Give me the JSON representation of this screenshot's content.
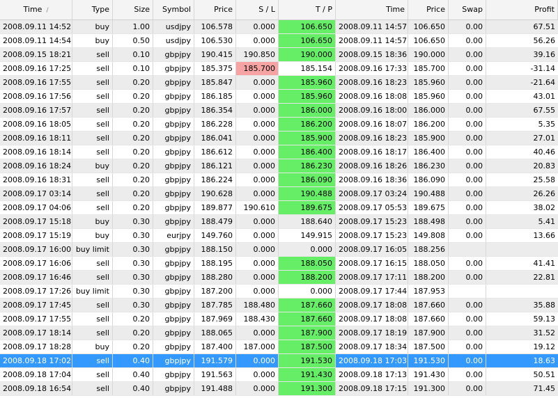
{
  "columns": [
    "Time",
    "Type",
    "Size",
    "Symbol",
    "Price",
    "S / L",
    "T / P",
    "Time",
    "Price",
    "Swap",
    "Profit"
  ],
  "sort_indicator": "/",
  "rows": [
    {
      "open_time": "2008.09.11 14:52",
      "type": "buy",
      "size": "1.00",
      "symbol": "usdjpy",
      "price": "106.578",
      "sl": "0.000",
      "tp": "106.650",
      "close_time": "2008.09.11 14:57",
      "close_price": "106.650",
      "swap": "0.00",
      "profit": "67.51",
      "tp_hit": true,
      "sl_hit": false
    },
    {
      "open_time": "2008.09.11 14:54",
      "type": "buy",
      "size": "0.50",
      "symbol": "usdjpy",
      "price": "106.530",
      "sl": "0.000",
      "tp": "106.650",
      "close_time": "2008.09.11 14:57",
      "close_price": "106.650",
      "swap": "0.00",
      "profit": "56.26",
      "tp_hit": true,
      "sl_hit": false
    },
    {
      "open_time": "2008.09.15 18:21",
      "type": "sell",
      "size": "0.10",
      "symbol": "gbpjpy",
      "price": "190.415",
      "sl": "190.850",
      "tp": "190.000",
      "close_time": "2008.09.15 18:36",
      "close_price": "190.000",
      "swap": "0.00",
      "profit": "39.16",
      "tp_hit": true,
      "sl_hit": false
    },
    {
      "open_time": "2008.09.16 17:25",
      "type": "sell",
      "size": "0.10",
      "symbol": "gbpjpy",
      "price": "185.375",
      "sl": "185.700",
      "tp": "185.154",
      "close_time": "2008.09.16 17:33",
      "close_price": "185.700",
      "swap": "0.00",
      "profit": "-31.14",
      "tp_hit": false,
      "sl_hit": true
    },
    {
      "open_time": "2008.09.16 17:55",
      "type": "sell",
      "size": "0.20",
      "symbol": "gbpjpy",
      "price": "185.847",
      "sl": "0.000",
      "tp": "185.960",
      "close_time": "2008.09.16 18:23",
      "close_price": "185.960",
      "swap": "0.00",
      "profit": "-21.64",
      "tp_hit": true,
      "sl_hit": false
    },
    {
      "open_time": "2008.09.16 17:56",
      "type": "sell",
      "size": "0.20",
      "symbol": "gbpjpy",
      "price": "186.185",
      "sl": "0.000",
      "tp": "185.960",
      "close_time": "2008.09.16 18:08",
      "close_price": "185.960",
      "swap": "0.00",
      "profit": "43.01",
      "tp_hit": true,
      "sl_hit": false
    },
    {
      "open_time": "2008.09.16 17:57",
      "type": "sell",
      "size": "0.20",
      "symbol": "gbpjpy",
      "price": "186.354",
      "sl": "0.000",
      "tp": "186.000",
      "close_time": "2008.09.16 18:00",
      "close_price": "186.000",
      "swap": "0.00",
      "profit": "67.55",
      "tp_hit": true,
      "sl_hit": false
    },
    {
      "open_time": "2008.09.16 18:05",
      "type": "sell",
      "size": "0.20",
      "symbol": "gbpjpy",
      "price": "186.228",
      "sl": "0.000",
      "tp": "186.200",
      "close_time": "2008.09.16 18:07",
      "close_price": "186.200",
      "swap": "0.00",
      "profit": "5.35",
      "tp_hit": true,
      "sl_hit": false
    },
    {
      "open_time": "2008.09.16 18:11",
      "type": "sell",
      "size": "0.20",
      "symbol": "gbpjpy",
      "price": "186.041",
      "sl": "0.000",
      "tp": "185.900",
      "close_time": "2008.09.16 18:23",
      "close_price": "185.900",
      "swap": "0.00",
      "profit": "27.01",
      "tp_hit": true,
      "sl_hit": false
    },
    {
      "open_time": "2008.09.16 18:14",
      "type": "sell",
      "size": "0.20",
      "symbol": "gbpjpy",
      "price": "186.612",
      "sl": "0.000",
      "tp": "186.400",
      "close_time": "2008.09.16 18:17",
      "close_price": "186.400",
      "swap": "0.00",
      "profit": "40.46",
      "tp_hit": true,
      "sl_hit": false
    },
    {
      "open_time": "2008.09.16 18:24",
      "type": "buy",
      "size": "0.20",
      "symbol": "gbpjpy",
      "price": "186.121",
      "sl": "0.000",
      "tp": "186.230",
      "close_time": "2008.09.16 18:26",
      "close_price": "186.230",
      "swap": "0.00",
      "profit": "20.83",
      "tp_hit": true,
      "sl_hit": false
    },
    {
      "open_time": "2008.09.16 18:31",
      "type": "sell",
      "size": "0.20",
      "symbol": "gbpjpy",
      "price": "186.224",
      "sl": "0.000",
      "tp": "186.090",
      "close_time": "2008.09.16 18:36",
      "close_price": "186.090",
      "swap": "0.00",
      "profit": "25.58",
      "tp_hit": true,
      "sl_hit": false
    },
    {
      "open_time": "2008.09.17 03:14",
      "type": "sell",
      "size": "0.20",
      "symbol": "gbpjpy",
      "price": "190.628",
      "sl": "0.000",
      "tp": "190.488",
      "close_time": "2008.09.17 03:24",
      "close_price": "190.488",
      "swap": "0.00",
      "profit": "26.26",
      "tp_hit": true,
      "sl_hit": false
    },
    {
      "open_time": "2008.09.17 04:06",
      "type": "sell",
      "size": "0.20",
      "symbol": "gbpjpy",
      "price": "189.877",
      "sl": "190.610",
      "tp": "189.675",
      "close_time": "2008.09.17 05:53",
      "close_price": "189.675",
      "swap": "0.00",
      "profit": "38.02",
      "tp_hit": true,
      "sl_hit": false
    },
    {
      "open_time": "2008.09.17 15:18",
      "type": "buy",
      "size": "0.30",
      "symbol": "gbpjpy",
      "price": "188.479",
      "sl": "0.000",
      "tp": "188.640",
      "close_time": "2008.09.17 15:23",
      "close_price": "188.498",
      "swap": "0.00",
      "profit": "5.41",
      "tp_hit": false,
      "sl_hit": false
    },
    {
      "open_time": "2008.09.17 15:19",
      "type": "buy",
      "size": "0.30",
      "symbol": "eurjpy",
      "price": "149.760",
      "sl": "0.000",
      "tp": "149.915",
      "close_time": "2008.09.17 15:23",
      "close_price": "149.808",
      "swap": "0.00",
      "profit": "13.66",
      "tp_hit": false,
      "sl_hit": false
    },
    {
      "open_time": "2008.09.17 16:00",
      "type": "buy limit",
      "size": "0.30",
      "symbol": "gbpjpy",
      "price": "188.150",
      "sl": "0.000",
      "tp": "0.000",
      "close_time": "2008.09.17 16:05",
      "close_price": "188.256",
      "swap": "",
      "profit": "",
      "tp_hit": false,
      "sl_hit": false
    },
    {
      "open_time": "2008.09.17 16:06",
      "type": "sell",
      "size": "0.30",
      "symbol": "gbpjpy",
      "price": "188.195",
      "sl": "0.000",
      "tp": "188.050",
      "close_time": "2008.09.17 16:15",
      "close_price": "188.050",
      "swap": "0.00",
      "profit": "41.41",
      "tp_hit": true,
      "sl_hit": false
    },
    {
      "open_time": "2008.09.17 16:46",
      "type": "sell",
      "size": "0.30",
      "symbol": "gbpjpy",
      "price": "188.280",
      "sl": "0.000",
      "tp": "188.200",
      "close_time": "2008.09.17 17:11",
      "close_price": "188.200",
      "swap": "0.00",
      "profit": "22.81",
      "tp_hit": true,
      "sl_hit": false
    },
    {
      "open_time": "2008.09.17 17:26",
      "type": "buy limit",
      "size": "0.30",
      "symbol": "gbpjpy",
      "price": "187.200",
      "sl": "0.000",
      "tp": "0.000",
      "close_time": "2008.09.17 17:44",
      "close_price": "187.953",
      "swap": "",
      "profit": "",
      "tp_hit": false,
      "sl_hit": false
    },
    {
      "open_time": "2008.09.17 17:45",
      "type": "sell",
      "size": "0.30",
      "symbol": "gbpjpy",
      "price": "187.785",
      "sl": "188.480",
      "tp": "187.660",
      "close_time": "2008.09.17 18:08",
      "close_price": "187.660",
      "swap": "0.00",
      "profit": "35.88",
      "tp_hit": true,
      "sl_hit": false
    },
    {
      "open_time": "2008.09.17 17:55",
      "type": "sell",
      "size": "0.20",
      "symbol": "gbpjpy",
      "price": "187.969",
      "sl": "188.430",
      "tp": "187.660",
      "close_time": "2008.09.17 18:08",
      "close_price": "187.660",
      "swap": "0.00",
      "profit": "59.13",
      "tp_hit": true,
      "sl_hit": false
    },
    {
      "open_time": "2008.09.17 18:14",
      "type": "sell",
      "size": "0.20",
      "symbol": "gbpjpy",
      "price": "188.065",
      "sl": "0.000",
      "tp": "187.900",
      "close_time": "2008.09.17 18:19",
      "close_price": "187.900",
      "swap": "0.00",
      "profit": "31.52",
      "tp_hit": true,
      "sl_hit": false
    },
    {
      "open_time": "2008.09.17 18:28",
      "type": "buy",
      "size": "0.20",
      "symbol": "gbpjpy",
      "price": "187.400",
      "sl": "187.000",
      "tp": "187.500",
      "close_time": "2008.09.17 18:34",
      "close_price": "187.500",
      "swap": "0.00",
      "profit": "19.12",
      "tp_hit": true,
      "sl_hit": false
    },
    {
      "open_time": "2008.09.18 17:02",
      "type": "sell",
      "size": "0.40",
      "symbol": "gbpjpy",
      "price": "191.579",
      "sl": "0.000",
      "tp": "191.530",
      "close_time": "2008.09.18 17:03",
      "close_price": "191.530",
      "swap": "0.00",
      "profit": "18.63",
      "tp_hit": true,
      "sl_hit": false,
      "selected": true
    },
    {
      "open_time": "2008.09.18 17:04",
      "type": "sell",
      "size": "0.40",
      "symbol": "gbpjpy",
      "price": "191.563",
      "sl": "0.000",
      "tp": "191.430",
      "close_time": "2008.09.18 17:13",
      "close_price": "191.430",
      "swap": "0.00",
      "profit": "50.51",
      "tp_hit": true,
      "sl_hit": false
    },
    {
      "open_time": "2008.09.18 16:54",
      "type": "sell",
      "size": "0.40",
      "symbol": "gbpjpy",
      "price": "191.488",
      "sl": "0.000",
      "tp": "191.300",
      "close_time": "2008.09.18 17:15",
      "close_price": "191.300",
      "swap": "0.00",
      "profit": "71.45",
      "tp_hit": true,
      "sl_hit": false
    }
  ],
  "colors": {
    "tp_hit": "#66ee66",
    "sl_hit": "#f5a3a3",
    "selected": "#3399ff",
    "alt_row": "#ececec"
  }
}
